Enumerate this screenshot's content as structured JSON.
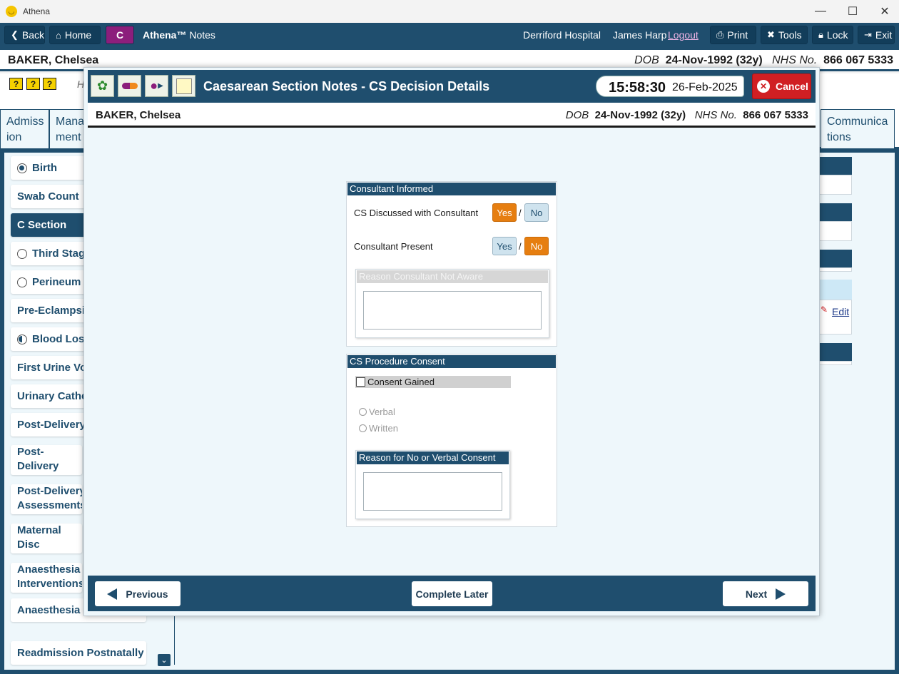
{
  "window": {
    "title": "Athena",
    "minimize": "—",
    "maximize": "☐",
    "close": "✕"
  },
  "toolbar": {
    "back": "Back",
    "home": "Home",
    "c_badge": "C",
    "app_brand": "Athena™",
    "app_module": "Notes",
    "hospital": "Derriford Hospital",
    "user": "James Harp",
    "logout": "Logout",
    "print": "Print",
    "tools": "Tools",
    "lock": "Lock",
    "exit": "Exit"
  },
  "patient": {
    "name": "BAKER, Chelsea",
    "dob_label": "DOB",
    "dob": "24-Nov-1992 (32y)",
    "nhs_label": "NHS No.",
    "nhs": "866 067 5333"
  },
  "background": {
    "sub_letter": "H",
    "tabs": [
      {
        "label": "Admiss ion"
      },
      {
        "label": "Mana ment"
      },
      {
        "label": "Communica tions"
      }
    ],
    "sidebar": [
      {
        "label": "Birth"
      },
      {
        "label": "Swab Count"
      },
      {
        "label": "C Section"
      },
      {
        "label": "Third Stage"
      },
      {
        "label": "Perineum"
      },
      {
        "label": "Pre-Eclampsia"
      },
      {
        "label": "Blood Loss"
      },
      {
        "label": "First Urine Voi"
      },
      {
        "label": "Urinary Cathe"
      },
      {
        "label": "Post-Delivery"
      },
      {
        "label": "Post-Delivery Notes"
      },
      {
        "label": "Post-Delivery Assessments"
      },
      {
        "label": "Maternal Disc Summary"
      },
      {
        "label": "Anaesthesia Interventions"
      },
      {
        "label": "Anaesthesia F"
      },
      {
        "label": "Readmission Postnatally"
      }
    ],
    "edit_link": "Edit"
  },
  "modal": {
    "title": "Caesarean Section Notes - CS Decision Details",
    "time": "15:58:30",
    "date": "26-Feb-2025",
    "cancel": "Cancel",
    "consultant_panel": {
      "title": "Consultant Informed",
      "discussed_label": "CS Discussed with Consultant",
      "discussed_value": "Yes",
      "present_label": "Consultant Present",
      "present_value": "No",
      "yes": "Yes",
      "no": "No",
      "separator": "/",
      "reason_title": "Reason Consultant Not Aware",
      "reason_value": ""
    },
    "consent_panel": {
      "title": "CS Procedure Consent",
      "consent_gained_label": "Consent Gained",
      "consent_gained": false,
      "verbal": "Verbal",
      "written": "Written",
      "reason_title": "Reason for No or Verbal Consent",
      "reason_value": ""
    },
    "footer": {
      "previous": "Previous",
      "complete_later": "Complete Later",
      "next": "Next"
    }
  },
  "colors": {
    "primary": "#1f4e6e",
    "selected": "#e67e10",
    "cancel": "#d01f23",
    "c_badge": "#8c1e7c"
  }
}
